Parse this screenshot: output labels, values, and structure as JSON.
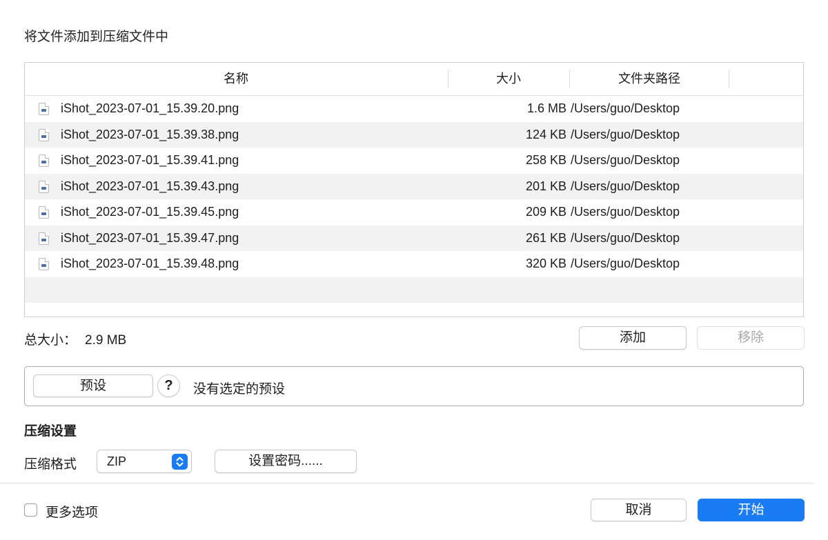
{
  "dialog": {
    "title": "将文件添加到压缩文件中"
  },
  "table": {
    "columns": {
      "name": "名称",
      "size": "大小",
      "path": "文件夹路径"
    },
    "rows": [
      {
        "name": "iShot_2023-07-01_15.39.20.png",
        "size": "1.6 MB",
        "path": "/Users/guo/Desktop"
      },
      {
        "name": "iShot_2023-07-01_15.39.38.png",
        "size": "124 KB",
        "path": "/Users/guo/Desktop"
      },
      {
        "name": "iShot_2023-07-01_15.39.41.png",
        "size": "258 KB",
        "path": "/Users/guo/Desktop"
      },
      {
        "name": "iShot_2023-07-01_15.39.43.png",
        "size": "201 KB",
        "path": "/Users/guo/Desktop"
      },
      {
        "name": "iShot_2023-07-01_15.39.45.png",
        "size": "209 KB",
        "path": "/Users/guo/Desktop"
      },
      {
        "name": "iShot_2023-07-01_15.39.47.png",
        "size": "261 KB",
        "path": "/Users/guo/Desktop"
      },
      {
        "name": "iShot_2023-07-01_15.39.48.png",
        "size": "320 KB",
        "path": "/Users/guo/Desktop"
      }
    ]
  },
  "total": {
    "label": "总大小：",
    "value": "2.9 MB"
  },
  "buttons": {
    "add": "添加",
    "remove": "移除",
    "cancel": "取消",
    "start": "开始"
  },
  "preset": {
    "button_label": "预设",
    "help": "?",
    "status": "没有选定的预设"
  },
  "compression": {
    "section_title": "压缩设置",
    "format_label": "压缩格式",
    "format_value": "ZIP",
    "password_button": "设置密码......"
  },
  "more_options": {
    "label": "更多选项",
    "checked": false
  },
  "colors": {
    "accent": "#1a7cf5",
    "row_alt": "#f2f2f2",
    "border": "#cfcfcf"
  },
  "icons": {
    "file": "png-file-icon",
    "stepper": "up-down-chevron-icon",
    "help": "question-mark-icon"
  }
}
